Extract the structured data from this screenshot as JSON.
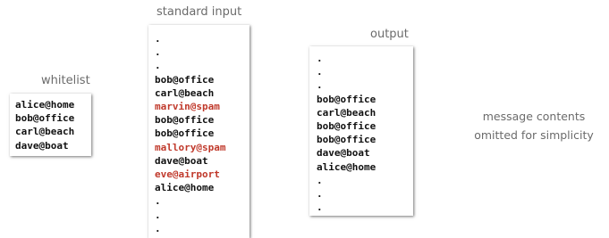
{
  "whitelist": {
    "title": "whitelist",
    "entries": [
      "alice@home",
      "bob@office",
      "carl@beach",
      "dave@boat"
    ]
  },
  "standard_input": {
    "title": "standard input",
    "lines": [
      {
        "text": ".",
        "rejected": false
      },
      {
        "text": ".",
        "rejected": false
      },
      {
        "text": ".",
        "rejected": false
      },
      {
        "text": "bob@office",
        "rejected": false
      },
      {
        "text": "carl@beach",
        "rejected": false
      },
      {
        "text": "marvin@spam",
        "rejected": true
      },
      {
        "text": "bob@office",
        "rejected": false
      },
      {
        "text": "bob@office",
        "rejected": false
      },
      {
        "text": "mallory@spam",
        "rejected": true
      },
      {
        "text": "dave@boat",
        "rejected": false
      },
      {
        "text": "eve@airport",
        "rejected": true
      },
      {
        "text": "alice@home",
        "rejected": false
      },
      {
        "text": ".",
        "rejected": false
      },
      {
        "text": ".",
        "rejected": false
      },
      {
        "text": ".",
        "rejected": false
      }
    ]
  },
  "output": {
    "title": "output",
    "lines": [
      ".",
      ".",
      ".",
      "bob@office",
      "carl@beach",
      "bob@office",
      "bob@office",
      "dave@boat",
      "alice@home",
      ".",
      ".",
      "."
    ]
  },
  "note": {
    "line1": "message contents",
    "line2": "omitted for simplicity"
  },
  "colors": {
    "accepted_text": "#111111",
    "rejected_text": "#c0392b",
    "caption_text": "#6b6b6b"
  }
}
